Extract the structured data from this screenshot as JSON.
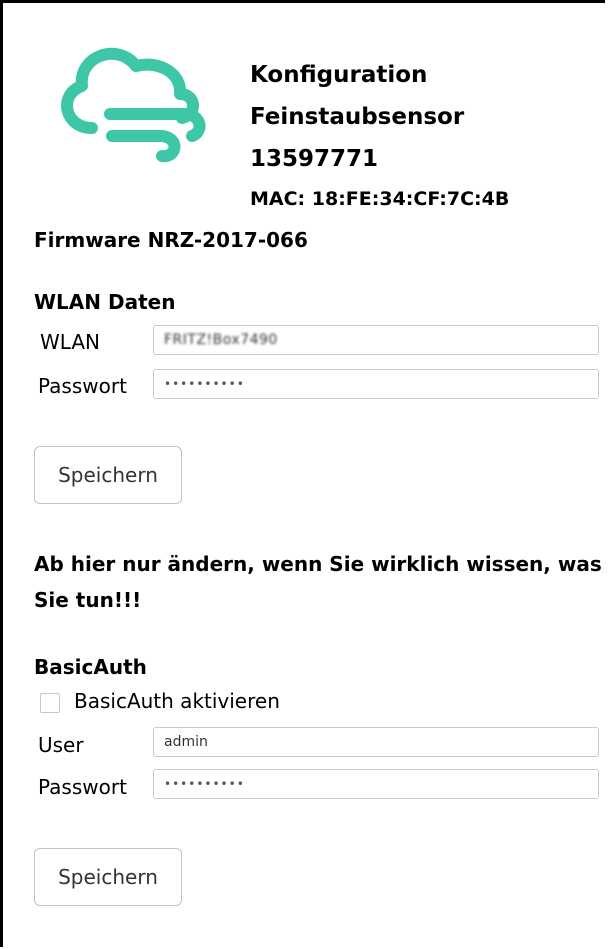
{
  "header": {
    "title_line1": "Konfiguration",
    "title_line2": "Feinstaubsensor",
    "sensor_id": "13597771",
    "mac": "MAC: 18:FE:34:CF:7C:4B",
    "logo_icon": "cloud-wind-icon",
    "logo_color": "#3ec7a6"
  },
  "firmware": "Firmware NRZ-2017-066",
  "wlan": {
    "section_title": "WLAN Daten",
    "ssid_label": "WLAN",
    "ssid_value": "FRITZ!Box7490",
    "password_label": "Passwort",
    "password_value": "••••••••••",
    "save_label": "Speichern"
  },
  "warning": "Ab hier nur ändern, wenn Sie wirklich wissen, was Sie tun!!!",
  "basicauth": {
    "section_title": "BasicAuth",
    "enable_label": "BasicAuth aktivieren",
    "enabled": false,
    "user_label": "User",
    "user_value": "admin",
    "password_label": "Passwort",
    "password_value": "••••••••••",
    "save_label": "Speichern"
  }
}
